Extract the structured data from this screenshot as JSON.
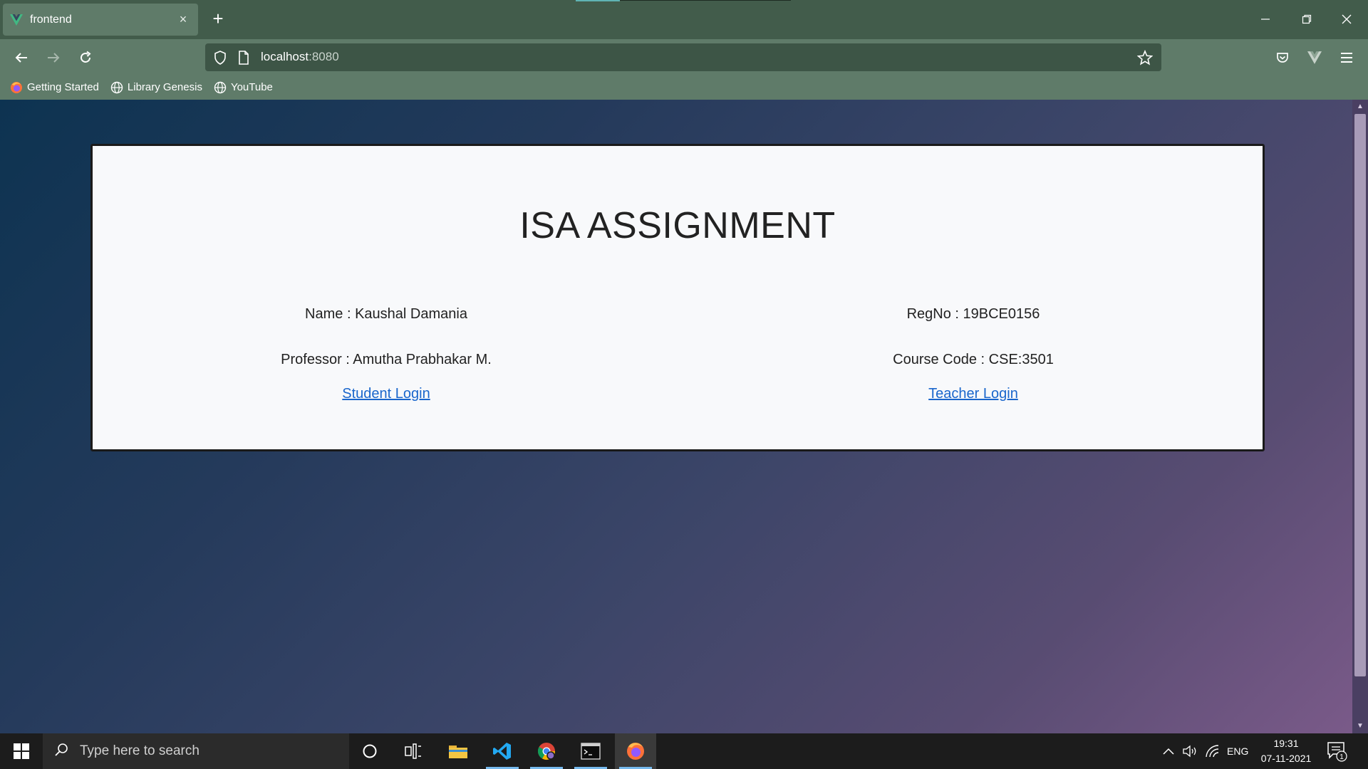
{
  "browser": {
    "tab_title": "frontend",
    "tab_close": "×",
    "new_tab": "+",
    "url_host": "localhost",
    "url_port": ":8080",
    "bookmarks": [
      {
        "label": "Getting Started",
        "icon": "firefox-icon"
      },
      {
        "label": "Library Genesis",
        "icon": "globe-icon"
      },
      {
        "label": "YouTube",
        "icon": "globe-icon"
      }
    ],
    "accent": "#425c4b"
  },
  "page": {
    "title": "ISA ASSIGNMENT",
    "name": "Name : Kaushal Damania",
    "regno": "RegNo : 19BCE0156",
    "professor": "Professor : Amutha Prabhakar M.",
    "course_code": "Course Code : CSE:3501",
    "student_login": "Student Login",
    "teacher_login": "Teacher Login",
    "link_color": "#1a66cc"
  },
  "taskbar": {
    "search_placeholder": "Type here to search",
    "language": "ENG",
    "time": "19:31",
    "date": "07-11-2021",
    "notification_count": "1"
  }
}
